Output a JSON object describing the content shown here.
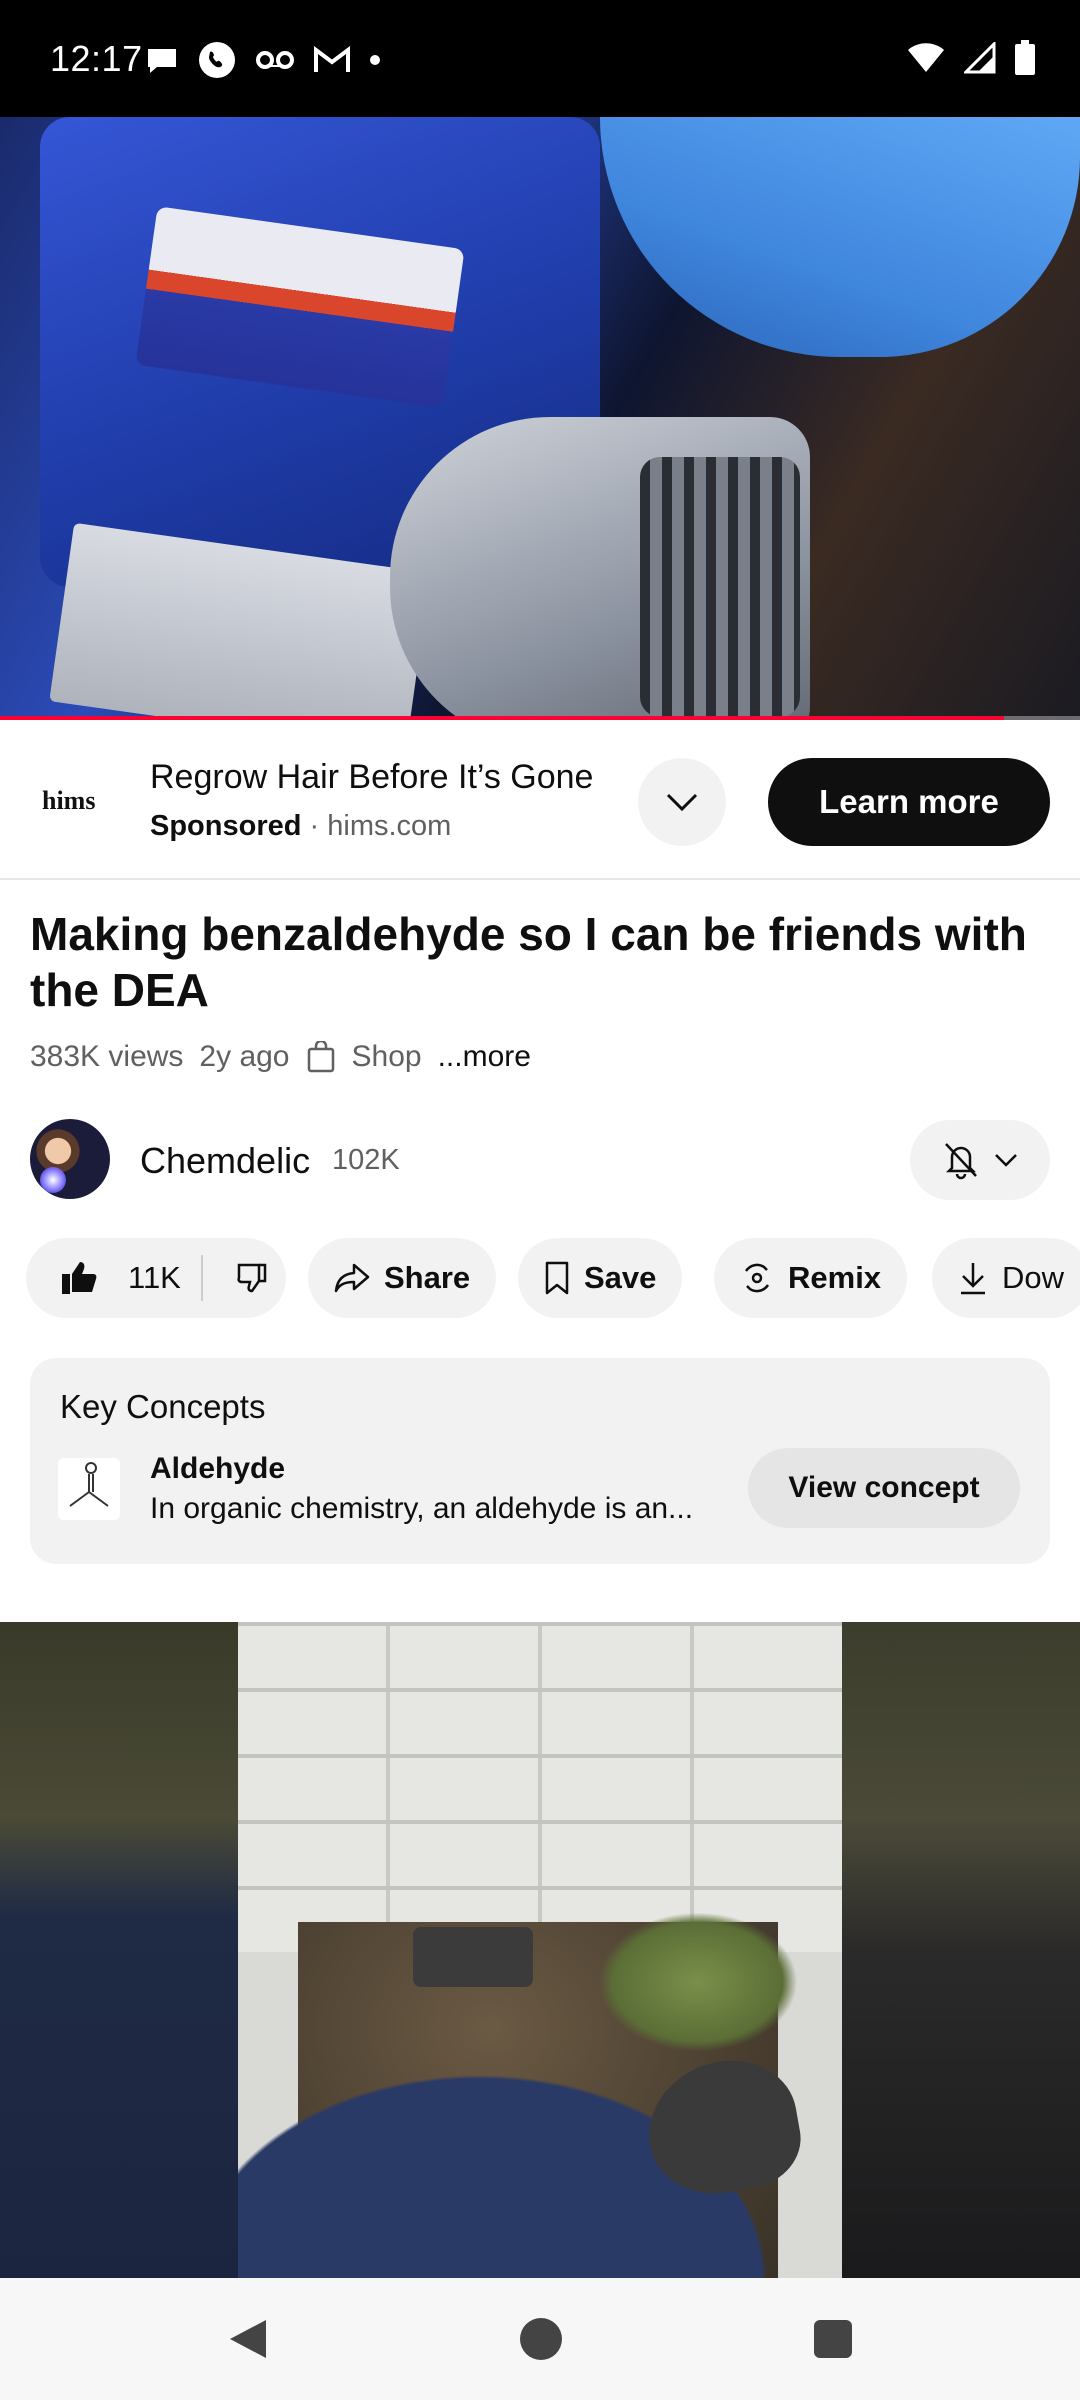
{
  "status_bar": {
    "time": "12:17"
  },
  "player": {
    "progress_percent": 93,
    "icons": [
      "pump-scene"
    ]
  },
  "ad": {
    "logo_text": "hims",
    "title": "Regrow Hair Before It’s Gone",
    "sponsored_label": "Sponsored",
    "separator": "·",
    "domain": "hims.com",
    "cta_label": "Learn more"
  },
  "video": {
    "title": "Making benzaldehyde so I can be friends with the DEA",
    "views": "383K views",
    "age": "2y ago",
    "shop_label": "Shop",
    "more_label": "...more"
  },
  "channel": {
    "name": "Chemdelic",
    "subscribers": "102K"
  },
  "actions": {
    "like_count": "11K",
    "share_label": "Share",
    "save_label": "Save",
    "remix_label": "Remix",
    "download_label": "Dow"
  },
  "concepts": {
    "heading": "Key Concepts",
    "item_name": "Aldehyde",
    "item_description": "In organic chemistry, an aldehyde is an...",
    "view_label": "View concept"
  },
  "colors": {
    "accent_red": "#ff0033",
    "chip_bg": "#f2f2f2",
    "text_primary": "#0f0f0f",
    "text_secondary": "#606060"
  }
}
